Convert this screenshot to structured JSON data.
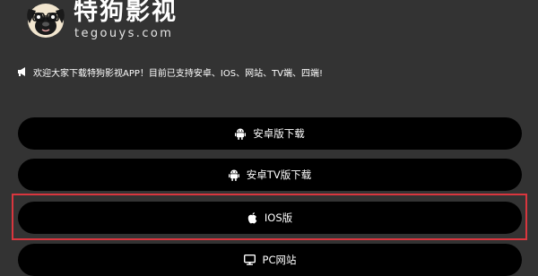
{
  "brand": {
    "name": "特狗影视",
    "domain": "tegouys.com",
    "logo_icon": "pug-logo-icon"
  },
  "notice": {
    "icon": "megaphone-icon",
    "text": "欢迎大家下载特狗影视APP！目前已支持安卓、IOS、网站、TV端、四端!"
  },
  "buttons": [
    {
      "label": "安卓版下载",
      "icon": "android-icon"
    },
    {
      "label": "安卓TV版下载",
      "icon": "android-icon"
    },
    {
      "label": "IOS版",
      "icon": "apple-icon"
    },
    {
      "label": "PC网站",
      "icon": "monitor-icon"
    }
  ],
  "colors": {
    "background": "#333333",
    "button": "#000000",
    "text": "#ffffff",
    "highlight_border": "#d9363e"
  }
}
